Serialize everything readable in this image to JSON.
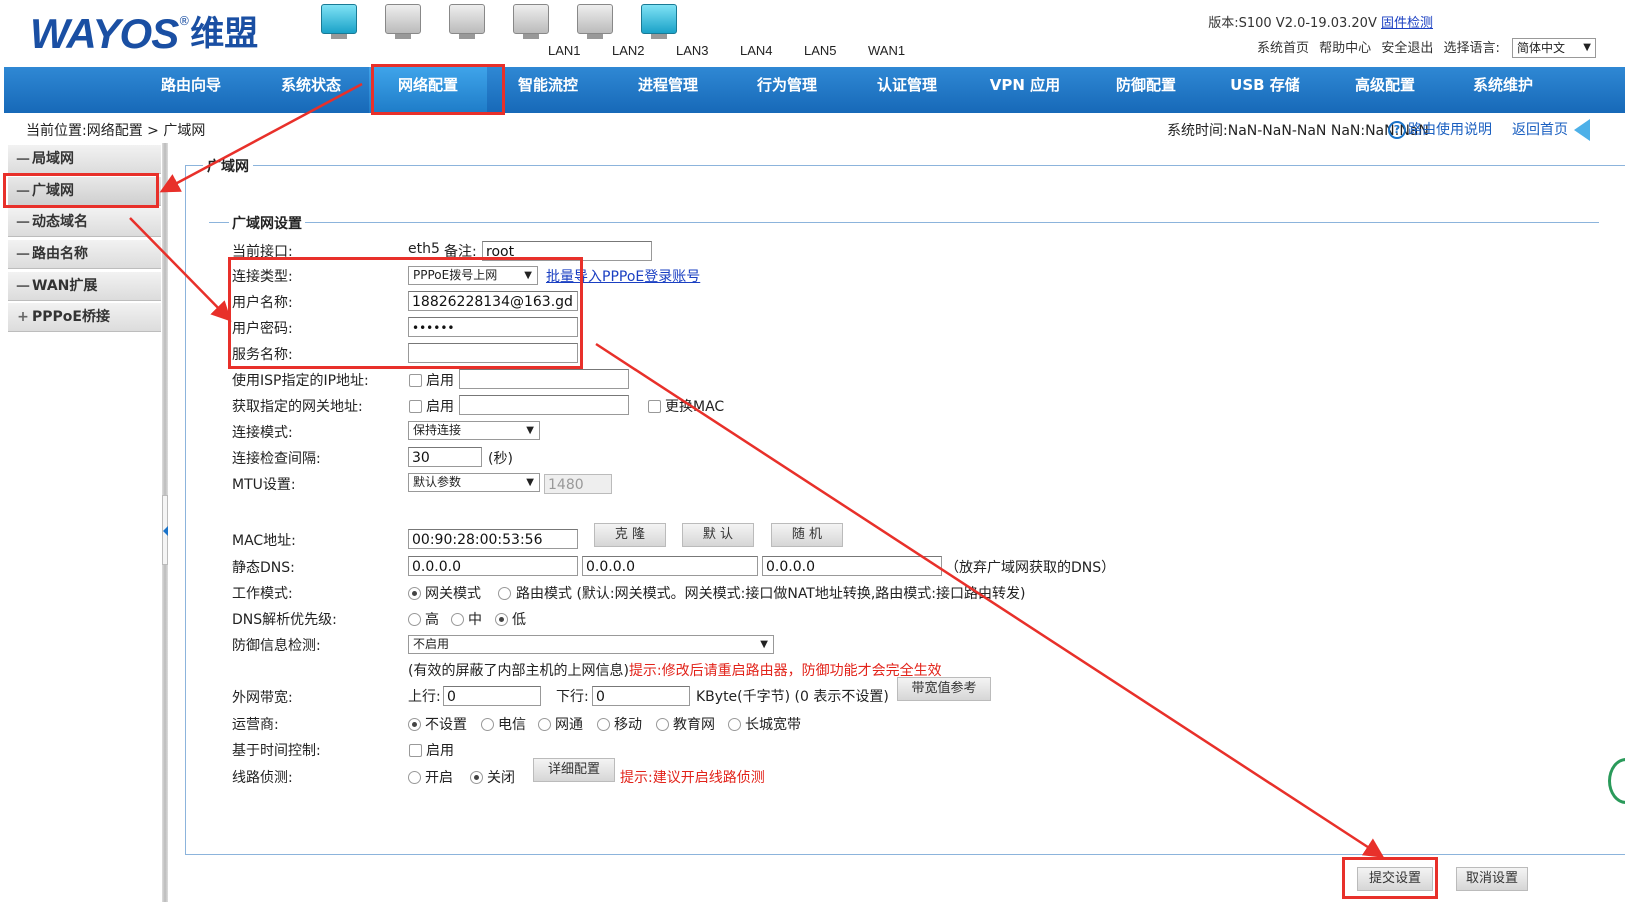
{
  "header": {
    "logo_en": "WAYOS",
    "logo_reg": "®",
    "logo_cn": "维盟",
    "ports": [
      {
        "label": "LAN1",
        "active": true
      },
      {
        "label": "LAN2",
        "active": false
      },
      {
        "label": "LAN3",
        "active": false
      },
      {
        "label": "LAN4",
        "active": false
      },
      {
        "label": "LAN5",
        "active": false
      },
      {
        "label": "WAN1",
        "active": true
      }
    ],
    "version": "版本:S100 V2.0-19.03.20V",
    "firmware_check": "固件检测",
    "links": [
      "系统首页",
      "帮助中心",
      "安全退出",
      "选择语言:"
    ],
    "language": "简体中文"
  },
  "nav": [
    "路由向导",
    "系统状态",
    "网络配置",
    "智能流控",
    "进程管理",
    "行为管理",
    "认证管理",
    "VPN 应用",
    "防御配置",
    "USB 存储",
    "高级配置",
    "系统维护"
  ],
  "nav_active": "网络配置",
  "breadcrumb": "当前位置:网络配置 > 广域网",
  "system_time": "系统时间:NaN-NaN-NaN NaN:NaN:NaN",
  "help_link": "路由使用说明",
  "home_link": "返回首页",
  "sidebar": [
    {
      "label": "局域网",
      "marker": "—"
    },
    {
      "label": "广域网",
      "marker": "—"
    },
    {
      "label": "动态域名",
      "marker": "—"
    },
    {
      "label": "路由名称",
      "marker": "—"
    },
    {
      "label": "WAN扩展",
      "marker": "—"
    },
    {
      "label": "PPPoE桥接",
      "marker": "+"
    }
  ],
  "form": {
    "section_title": "广域网",
    "subsection_title": "广域网设置",
    "current_interface_label": "当前接口:",
    "current_interface_value": "eth5",
    "remark_label": "备注:",
    "remark_value": "root",
    "conn_type_label": "连接类型:",
    "conn_type_value": "PPPoE拨号上网",
    "batch_import_link": "批量导入PPPoE登录账号",
    "username_label": "用户名称:",
    "username_value": "18826228134@163.gd",
    "password_label": "用户密码:",
    "password_value": "••••••",
    "service_label": "服务名称:",
    "service_value": "",
    "isp_ip_label": "使用ISP指定的IP地址:",
    "enable_label": "启用",
    "gateway_label": "获取指定的网关地址:",
    "change_mac_label": "更换MAC",
    "conn_mode_label": "连接模式:",
    "conn_mode_value": "保持连接",
    "check_interval_label": "连接检查间隔:",
    "check_interval_value": "30",
    "check_interval_unit": "(秒)",
    "mtu_label": "MTU设置:",
    "mtu_mode_value": "默认参数",
    "mtu_value": "1480",
    "mac_label": "MAC地址:",
    "mac_value": "00:90:28:00:53:56",
    "mac_buttons": [
      "克 隆",
      "默 认",
      "随 机"
    ],
    "dns_label": "静态DNS:",
    "dns_values": [
      "0.0.0.0",
      "0.0.0.0",
      "0.0.0.0"
    ],
    "dns_note": "（放弃广域网获取的DNS）",
    "work_mode_label": "工作模式:",
    "work_mode_options": [
      "网关模式",
      "路由模式 (默认:网关模式。网关模式:接口做NAT地址转换,路由模式:接口路由转发)"
    ],
    "dns_priority_label": "DNS解析优先级:",
    "dns_priority_options": [
      "高",
      "中",
      "低"
    ],
    "defense_label": "防御信息检测:",
    "defense_value": "不启用",
    "defense_note": "(有效的屏蔽了内部主机的上网信息)",
    "defense_warn": "提示:修改后请重启路由器，防御功能才会完全生效",
    "bandwidth_label": "外网带宽:",
    "up_label": "上行:",
    "up_value": "0",
    "down_label": "下行:",
    "down_value": "0",
    "bandwidth_unit": "KByte(千字节) (0 表示不设置)",
    "bandwidth_ref_button": "带宽值参考",
    "isp_label": "运营商:",
    "isp_options": [
      "不设置",
      "电信",
      "网通",
      "移动",
      "教育网",
      "长城宽带"
    ],
    "time_control_label": "基于时间控制:",
    "line_detect_label": "线路侦测:",
    "line_detect_options": [
      "开启",
      "关闭"
    ],
    "detail_config_button": "详细配置",
    "line_detect_warn": "提示:建议开启线路侦测"
  },
  "footer_buttons": {
    "submit": "提交设置",
    "cancel": "取消设置"
  },
  "colors": {
    "nav_bg": "#1769b8",
    "accent": "#1a4fa3",
    "annotation": "#e8302a",
    "warn": "#e2231a"
  }
}
